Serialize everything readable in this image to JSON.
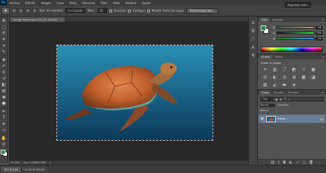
{
  "app": {
    "logo_text": "Ps"
  },
  "menu": [
    "Archivo",
    "Edición",
    "Imagen",
    "Capa",
    "Texto",
    "Selección",
    "Filtro",
    "Vista",
    "Ventana",
    "Ayuda"
  ],
  "options_bar": {
    "size_label": "Tam. de muestra:",
    "size_value": "3 x 3 prom.",
    "tolerance_label": "Toler.:",
    "tolerance_value": "32",
    "antialias_label": "Suavizar",
    "contiguous_label": "Contiguo",
    "sample_all_label": "Muestr. todas las capas",
    "refine_button": "Perfeccionar bor...",
    "workspace": "Aspectos esen..."
  },
  "document": {
    "tab_title": "Tortuga Marina.jpg al 33,3% (RGB/8)",
    "zoom": "33,33%",
    "status": "Doc: 5,28M/5,28M"
  },
  "bottom_tabs": [
    "Mini Bridge",
    "Línea de tiempo"
  ],
  "color_panel": {
    "tabs": [
      "Color",
      "Muestras"
    ],
    "fg_color": "#2e8b3b",
    "bg_color": "#ffffff",
    "sliders": [
      {
        "label": "R",
        "value": "46"
      },
      {
        "label": "G",
        "value": "139"
      },
      {
        "label": "B",
        "value": "59"
      }
    ]
  },
  "adjustments_panel": {
    "tabs": [
      "Ajustes",
      "Estilos"
    ],
    "title": "Añadir un ajuste",
    "icons": [
      "brightness-icon",
      "levels-icon",
      "curves-icon",
      "exposure-icon",
      "vibrance-icon",
      "hue-saturation-icon",
      "color-balance-icon",
      "black-white-icon",
      "photo-filter-icon",
      "channel-mixer-icon",
      "color-lookup-icon",
      "invert-icon",
      "posterize-icon",
      "threshold-icon",
      "gradient-map-icon",
      "selective-color-icon"
    ]
  },
  "layers_panel": {
    "tabs": [
      "Capas",
      "Canales",
      "Trazados"
    ],
    "filter_label": "Tipo",
    "blend_mode": "Normal",
    "opacity_label": "Opacidad:",
    "fill_label": "Relleno:",
    "layer_name": "Fondo"
  },
  "image": {
    "water_top": "#2a8fb5",
    "water_bottom": "#0b3a5c"
  }
}
